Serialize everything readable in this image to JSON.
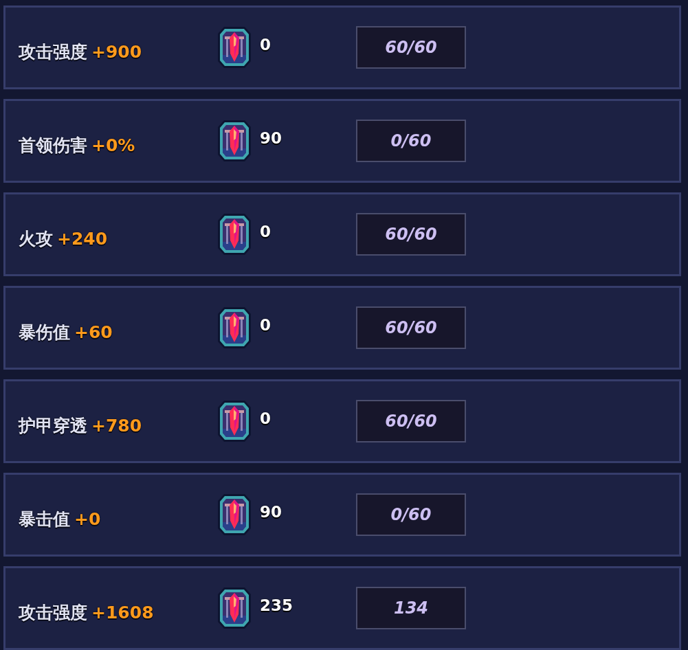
{
  "rows": [
    {
      "label": "攻击强度",
      "bonus": "+900",
      "gem_count": "0",
      "counter": "60/60"
    },
    {
      "label": "首领伤害",
      "bonus": "+0%",
      "gem_count": "90",
      "counter": "0/60"
    },
    {
      "label": "火攻",
      "bonus": "+240",
      "gem_count": "0",
      "counter": "60/60"
    },
    {
      "label": "暴伤值",
      "bonus": "+60",
      "gem_count": "0",
      "counter": "60/60"
    },
    {
      "label": "护甲穿透",
      "bonus": "+780",
      "gem_count": "0",
      "counter": "60/60"
    },
    {
      "label": "暴击值",
      "bonus": "+0",
      "gem_count": "90",
      "counter": "0/60"
    },
    {
      "label": "攻击强度",
      "bonus": "+1608",
      "gem_count": "235",
      "counter": "134"
    }
  ]
}
